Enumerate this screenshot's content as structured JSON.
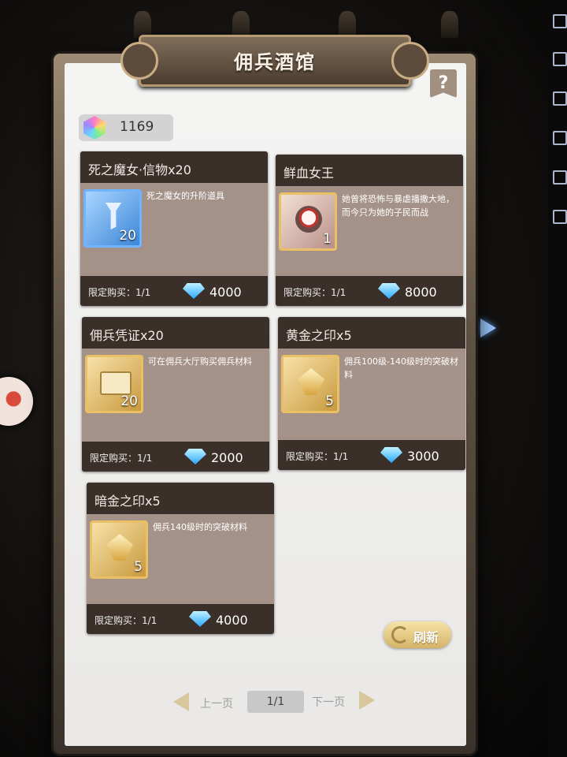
{
  "window": {
    "title": "佣兵酒馆",
    "help_label": "?"
  },
  "currency": {
    "icon": "rainbow-crystal-icon",
    "value": "1169"
  },
  "items": [
    {
      "name": "死之魔女·信物x20",
      "icon": "witch-token-icon",
      "count": "20",
      "description": "死之魔女的升阶道具",
      "limit": "限定购买：1/1",
      "price": "4000"
    },
    {
      "name": "鲜血女王",
      "icon": "blood-queen-portrait-icon",
      "count": "1",
      "description": "她曾将恐怖与暴虐播撒大地，而今只为她的子民而战",
      "limit": "限定购买：1/1",
      "price": "8000"
    },
    {
      "name": "佣兵凭证x20",
      "icon": "mercenary-voucher-icon",
      "count": "20",
      "description": "可在佣兵大厅购买佣兵材料",
      "limit": "限定购买：1/1",
      "price": "2000"
    },
    {
      "name": "黄金之印x5",
      "icon": "gold-seal-icon",
      "count": "5",
      "description": "佣兵100级-140级时的突破材料",
      "limit": "限定购买：1/1",
      "price": "3000"
    },
    {
      "name": "暗金之印x5",
      "icon": "dark-gold-seal-icon",
      "count": "5",
      "description": "佣兵140级时的突破材料",
      "limit": "限定购买：1/1",
      "price": "4000"
    }
  ],
  "price_icon": "blue-diamond-icon",
  "refresh": {
    "label": "刷新",
    "icon": "refresh-icon"
  },
  "pager": {
    "prev_label": "上一页",
    "page": "1/1",
    "next_label": "下一页"
  }
}
